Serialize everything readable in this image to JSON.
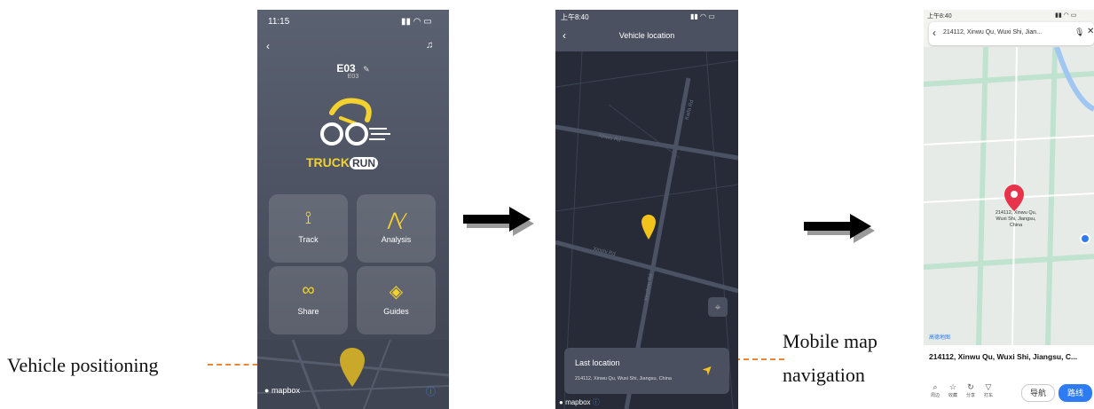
{
  "labels": {
    "vehicle_positioning": "Vehicle positioning",
    "mobile_map_line1": "Mobile map",
    "mobile_map_line2": "navigation"
  },
  "phone1": {
    "time": "11:15",
    "device_name": "E03",
    "device_sub": "E03",
    "logo_truck": "TRUCK",
    "logo_run": "RUN",
    "tiles": [
      {
        "label": "Track",
        "icon": "track-icon"
      },
      {
        "label": "Analysis",
        "icon": "chart-icon"
      },
      {
        "label": "Share",
        "icon": "share-icon"
      },
      {
        "label": "Guides",
        "icon": "compass-icon"
      }
    ],
    "mapbox": "mapbox"
  },
  "phone2": {
    "status_time": "上午8:40",
    "title": "Vehicle location",
    "streets": [
      "Xinwu Rd",
      "Kaifa Rd",
      "Xinzhou Rd",
      "Xinshi Rd"
    ],
    "last_location_label": "Last location",
    "address": "214112, Xinwu Qu, Wuxi Shi, Jiangsu, China",
    "mapbox": "mapbox"
  },
  "phone3": {
    "status_time": "上午8:40",
    "search_text": "214112, Xinwu Qu, Wuxi Shi, Jian...",
    "pin_label": "214112, Xinwu Qu, Wuxi Shi, Jiangsu, China",
    "map_brand": "高德地图",
    "address_line": "214112, Xinwu Qu, Wuxi Shi, Jiangsu, C...",
    "actions": [
      "周边",
      "收藏",
      "分享",
      "打车"
    ],
    "nav_button": "导航",
    "route_button": "路线"
  },
  "colors": {
    "accent_yellow": "#f3d12f",
    "dash_orange": "#e8863a",
    "amap_blue": "#2d7cf6",
    "pin_red": "#e8344a"
  }
}
